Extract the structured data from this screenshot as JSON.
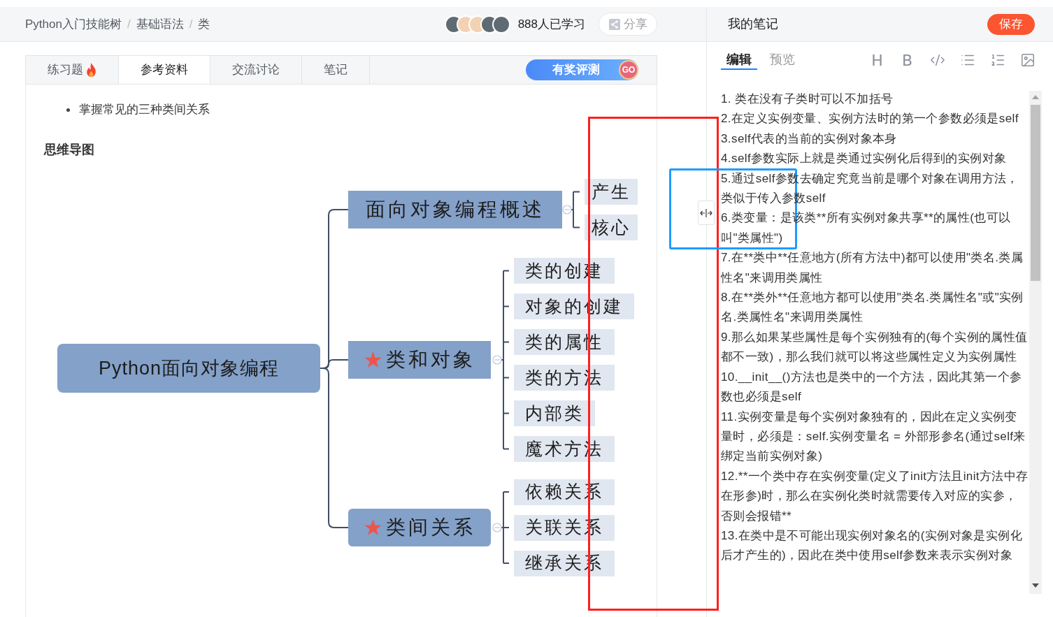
{
  "header": {
    "breadcrumb": [
      "Python入门技能树",
      "基础语法",
      "类"
    ],
    "separator": "/",
    "avatars": [
      {
        "kind": "photo"
      },
      {
        "kind": "cartoon"
      },
      {
        "kind": "cartoon"
      },
      {
        "kind": "photo"
      },
      {
        "kind": "photo"
      }
    ],
    "learners": "888人已学习",
    "share": "分享"
  },
  "tabs": [
    {
      "label": "练习题",
      "selected": false,
      "hot": true
    },
    {
      "label": "参考资料",
      "selected": true,
      "hot": false
    },
    {
      "label": "交流讨论",
      "selected": false,
      "hot": false
    },
    {
      "label": "笔记",
      "selected": false,
      "hot": false
    }
  ],
  "quiz_button": {
    "label": "有奖评测",
    "badge": "GO"
  },
  "content": {
    "bullets": [
      "掌握常见的三种类间关系"
    ],
    "heading": "思维导图"
  },
  "mind_map": {
    "root": "Python面向对象编程",
    "branches": [
      {
        "label": "面向对象编程概述",
        "starred": false,
        "children": [
          {
            "label": "产生"
          },
          {
            "label": "核心"
          }
        ]
      },
      {
        "label": "类和对象",
        "starred": true,
        "children": [
          {
            "label": "类的创建"
          },
          {
            "label": "对象的创建"
          },
          {
            "label": "类的属性"
          },
          {
            "label": "类的方法"
          },
          {
            "label": "内部类"
          },
          {
            "label": "魔术方法"
          }
        ]
      },
      {
        "label": "类间关系",
        "starred": true,
        "children": [
          {
            "label": "依赖关系"
          },
          {
            "label": "关联关系"
          },
          {
            "label": "继承关系"
          }
        ]
      }
    ]
  },
  "notes": {
    "title": "我的笔记",
    "save": "保存",
    "modes": [
      {
        "label": "编辑",
        "selected": true
      },
      {
        "label": "预览",
        "selected": false
      }
    ],
    "toolbar": [
      {
        "kind": "heading",
        "label": "H"
      },
      {
        "kind": "bold",
        "label": "B"
      },
      {
        "kind": "code"
      },
      {
        "kind": "bullet-list"
      },
      {
        "kind": "numbered-list"
      },
      {
        "kind": "image"
      }
    ],
    "paragraphs": [
      "1. 类在没有子类时可以不加括号",
      "2.在定义实例变量、实例方法时的第一个参数必须是self",
      "3.self代表的当前的实例对象本身",
      "4.self参数实际上就是类通过实例化后得到的实例对象",
      "5.通过self参数去确定究竟当前是哪个对象在调用方法，类似于传入参数self",
      "6.类变量：是该类**所有实例对象共享**的属性(也可以叫\"类属性\")",
      "7.在**类中**任意地方(所有方法中)都可以使用\"类名.类属性名\"来调用类属性",
      "8.在**类外**任意地方都可以使用\"类名.类属性名\"或\"实例名.类属性名\"来调用类属性",
      "9.那么如果某些属性是每个实例独有的(每个实例的属性值都不一致)，那么我们就可以将这些属性定义为实例属性",
      "10.__init__()方法也是类中的一个方法，因此其第一个参数也必须是self",
      "11.实例变量是每个实例对象独有的，因此在定义实例变量时，必须是：self.实例变量名 = 外部形参名(通过self来绑定当前实例对象)",
      "12.**一个类中存在实例变量(定义了init方法且init方法中存在形参)时，那么在实例化类时就需要传入对应的实参，否则会报错**",
      "13.在类中是不可能出现实例对象名的(实例对象是实例化后才产生的)，因此在类中使用self参数来表示实例对象"
    ]
  },
  "annotations": [
    {
      "kind": "frame",
      "color": "#ff1f1f"
    },
    {
      "kind": "frame",
      "color": "#1e9bff"
    }
  ]
}
